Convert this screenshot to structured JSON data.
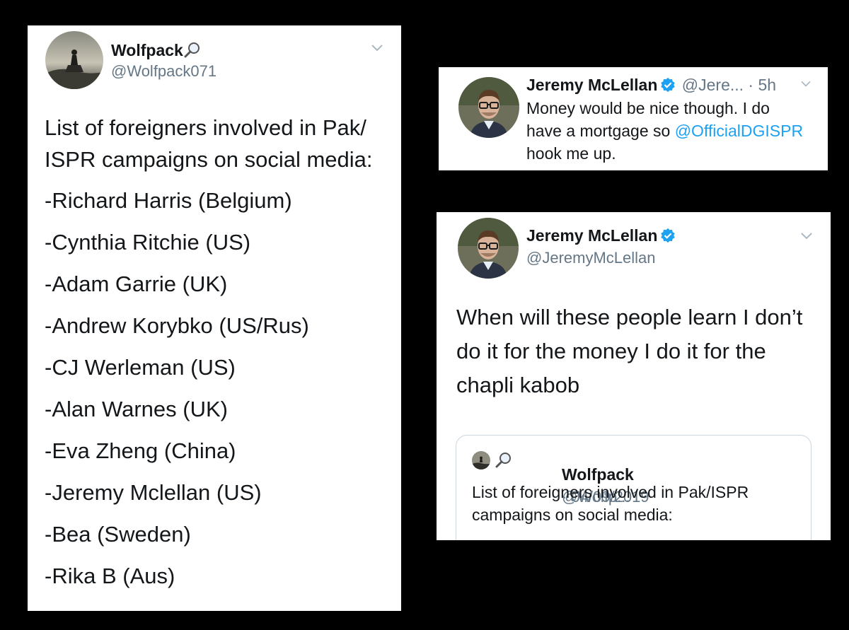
{
  "card1": {
    "name": "Wolfpack",
    "name_icon": "magnifying-glass-icon",
    "handle": "@Wolfpack071",
    "text": "List of foreigners involved in Pak/ ISPR campaigns on social media:",
    "list": [
      "-Richard Harris (Belgium)",
      "-Cynthia Ritchie (US)",
      "-Adam Garrie (UK)",
      "-Andrew Korybko (US/Rus)",
      "-CJ Werleman (US)",
      "-Alan Warnes (UK)",
      "-Eva Zheng (China)",
      "-Jeremy Mclellan (US)",
      "-Bea (Sweden)",
      "-Rika B (Aus)"
    ]
  },
  "card2": {
    "name": "Jeremy McLellan",
    "handle": "@Jere...",
    "time": "· 5h",
    "text_1": "Money would be nice though. I do have a mortgage so",
    "mention": "@OfficialDGISPR",
    "text_2": " hook me up."
  },
  "card3": {
    "name": "Jeremy McLellan",
    "handle": "@JeremyMcLellan",
    "text": "When will these people learn I don’t do it for the money I do it for the chapli kabob",
    "quote": {
      "name": "Wolfpack",
      "handle": "@Wolfp...",
      "date": "· 04/09/2019",
      "text": "List of foreigners involved in Pak/ISPR campaigns on social media:"
    }
  },
  "colors": {
    "link": "#1da1f2",
    "verified": "#1da1f2",
    "handle": "#657786",
    "background": "#000000"
  }
}
